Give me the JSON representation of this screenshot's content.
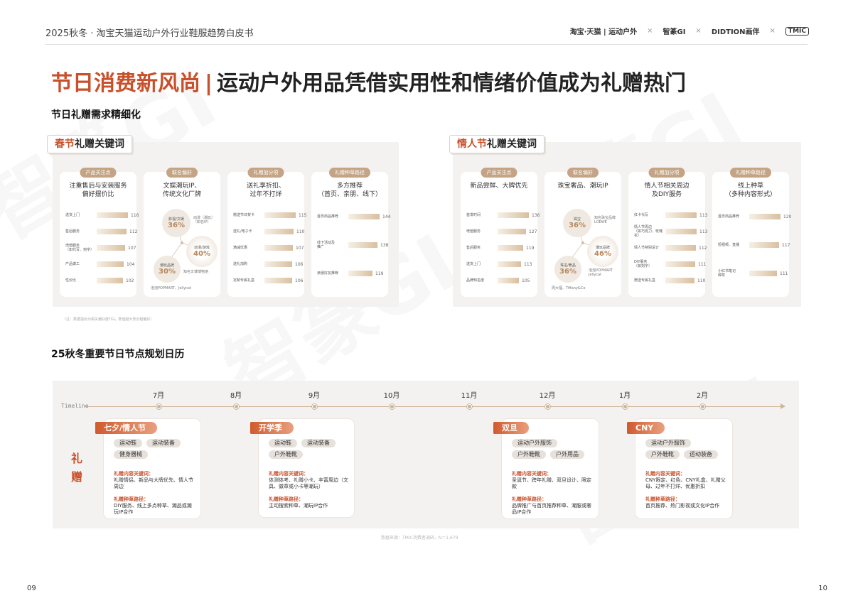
{
  "header": {
    "title": "2025秋冬 · 淘宝天猫运动户外行业鞋服趋势白皮书",
    "logos": [
      "淘宝·天猫 | 运动户外",
      "智篆GI",
      "DIDTION画伴",
      "TMIC"
    ],
    "sep": "×"
  },
  "title": {
    "red": "节日消费新风尚",
    "sep": "|",
    "rest": "运动户外用品凭借实用性和情绪价值成为礼赠热门"
  },
  "section1": "节日礼赠需求精细化",
  "spring": {
    "tag_red": "春节",
    "tag_rest": "礼赠关键词",
    "cards": [
      {
        "header": "产品关注点",
        "subtitle": "注重售后与安装服务\n偏好摆价比",
        "bars": [
          {
            "label": "送货上门",
            "value": "116",
            "w": 1.0
          },
          {
            "label": "售后服务",
            "value": "112",
            "w": 0.96
          },
          {
            "label": "增值服务\n（如代写、刻字）",
            "value": "107",
            "w": 0.9
          },
          {
            "label": "产品做工",
            "value": "104",
            "w": 0.86
          },
          {
            "label": "性价比",
            "value": "102",
            "w": 0.84
          }
        ]
      },
      {
        "header": "联名偏好",
        "subtitle": "文娱潮玩IP、\n传统文化厂牌",
        "bubbles": [
          {
            "label": "影视/文娱",
            "pct": "36%"
          },
          {
            "label": "动漫/游戏",
            "pct": "40%"
          },
          {
            "label": "潮玩品牌",
            "pct": "30%"
          }
        ],
        "mini": [
          "动漫（潮玩）\n（知名IP）",
          "知名文博博物馆"
        ],
        "brands": "泡泡POPMART、Jellycat"
      },
      {
        "header": "礼赠加分项",
        "subtitle": "送礼享折扣、\n过年不打烊",
        "bars": [
          {
            "label": "赠送节日贺卡",
            "value": "115",
            "w": 1.0
          },
          {
            "label": "送礼/电子卡",
            "value": "110",
            "w": 0.94
          },
          {
            "label": "满减优惠",
            "value": "107",
            "w": 0.9
          },
          {
            "label": "送礼加购",
            "value": "106",
            "w": 0.88
          },
          {
            "label": "定制专属礼盒",
            "value": "106",
            "w": 0.88
          }
        ]
      },
      {
        "header": "礼赠种草路径",
        "subtitle": "多方推荐\n（首页、亲朋、线下）",
        "bars": [
          {
            "label": "首页商品推荐",
            "value": "144",
            "w": 1.0
          },
          {
            "label": "线下活动及\n推广",
            "value": "138",
            "w": 0.94
          },
          {
            "label": "亲朋好友推荐",
            "value": "119",
            "w": 0.78
          }
        ]
      }
    ]
  },
  "valentine": {
    "tag_red": "情人节",
    "tag_rest": "礼赠关键词",
    "cards": [
      {
        "header": "产品关注点",
        "subtitle": "新品尝鲜、大牌优先",
        "bars": [
          {
            "label": "首发时间",
            "value": "136",
            "w": 1.0
          },
          {
            "label": "增值服务",
            "value": "127",
            "w": 0.9
          },
          {
            "label": "售后服务",
            "value": "119",
            "w": 0.82
          },
          {
            "label": "送货上门",
            "value": "113",
            "w": 0.76
          },
          {
            "label": "品牌知名度",
            "value": "105",
            "w": 0.68
          }
        ]
      },
      {
        "header": "联名偏好",
        "subtitle": "珠宝奢品、潮玩IP",
        "bubbles": [
          {
            "label": "珠宝",
            "pct": "36%"
          },
          {
            "label": "潮玩品牌",
            "pct": "46%"
          },
          {
            "label": "珠宝/奢品",
            "pct": "36%"
          }
        ],
        "mini": [
          "知名珠宝品牌\nLOEWE"
        ],
        "brands_center": "泡泡POPMART\nJellycat",
        "brands": "周大福、Tiffany&Co"
      },
      {
        "header": "礼赠加分项",
        "subtitle": "情人节相关周边\n及DIY服务",
        "bars": [
          {
            "label": "红卡代写",
            "value": "113",
            "w": 1.0
          },
          {
            "label": "情人节周边\n（如巧克力、玫瑰花）",
            "value": "113",
            "w": 1.0
          },
          {
            "label": "情人节特别设计",
            "value": "112",
            "w": 0.98
          },
          {
            "label": "DIY服务\n（如刻字）",
            "value": "111",
            "w": 0.96
          },
          {
            "label": "赠送专属礼盒",
            "value": "110",
            "w": 0.94
          }
        ]
      },
      {
        "header": "礼赠种草路径",
        "subtitle": "线上种草\n（多种内容形式）",
        "bars": [
          {
            "label": "首页商品推荐",
            "value": "120",
            "w": 1.0
          },
          {
            "label": "短视频、直播",
            "value": "117",
            "w": 0.96
          },
          {
            "label": "小红书笔记\n种草",
            "value": "111",
            "w": 0.88
          }
        ]
      }
    ]
  },
  "note": "（注：数据指标为相关偏好度TGI，数值越大表示越偏好）",
  "section2": "25秋冬重要节日节点规划日历",
  "timeline": {
    "label": "Timeline",
    "months": [
      "7月",
      "8月",
      "9月",
      "10月",
      "11月",
      "12月",
      "1月",
      "2月"
    ],
    "gift": [
      "礼",
      "赠"
    ],
    "events": [
      {
        "name": "七夕/情人节",
        "chips": [
          "运动鞋",
          "运动装备",
          "健身器械"
        ],
        "kw_label": "礼赠内容关键词：",
        "kw_text": "礼赠情侣、新品与大牌优先、情人节周边",
        "path_label": "礼赠种草路径：",
        "path_text": "DIY服务、线上多点种草、潮品或潮玩IP合作"
      },
      {
        "name": "开学季",
        "chips": [
          "运动鞋",
          "运动装备",
          "户外鞋靴"
        ],
        "kw_label": "礼赠内容关键词：",
        "kw_text": "体测体考、礼赠小卡、丰富周边（文具、徽章或小卡等潮玩）",
        "path_label": "礼赠种草路径：",
        "path_text": "主动搜索种草、潮玩IP合作"
      },
      {
        "name": "双旦",
        "chips": [
          "运动户外服饰",
          "户外鞋靴",
          "户外用品"
        ],
        "kw_label": "礼赠内容关键词：",
        "kw_text": "圣诞节、跨年礼赠、双旦设计、限定款",
        "path_label": "礼赠种草路径：",
        "path_text": "品牌推广与首页推荐种草、潮服或奢品IP合作"
      },
      {
        "name": "CNY",
        "chips": [
          "运动户外服饰",
          "户外鞋靴",
          "运动装备"
        ],
        "kw_label": "礼赠内容关键词：",
        "kw_text": "CNY限定、红色、CNY礼盒、礼赠父母、过年不打烊、优惠折扣",
        "path_label": "礼赠种草路径：",
        "path_text": "首页推荐、热门影视或文化IP合作"
      }
    ]
  },
  "source": "数据来源：TMIC消费者调研，N＝1,679",
  "page_left": "09",
  "page_right": "10"
}
